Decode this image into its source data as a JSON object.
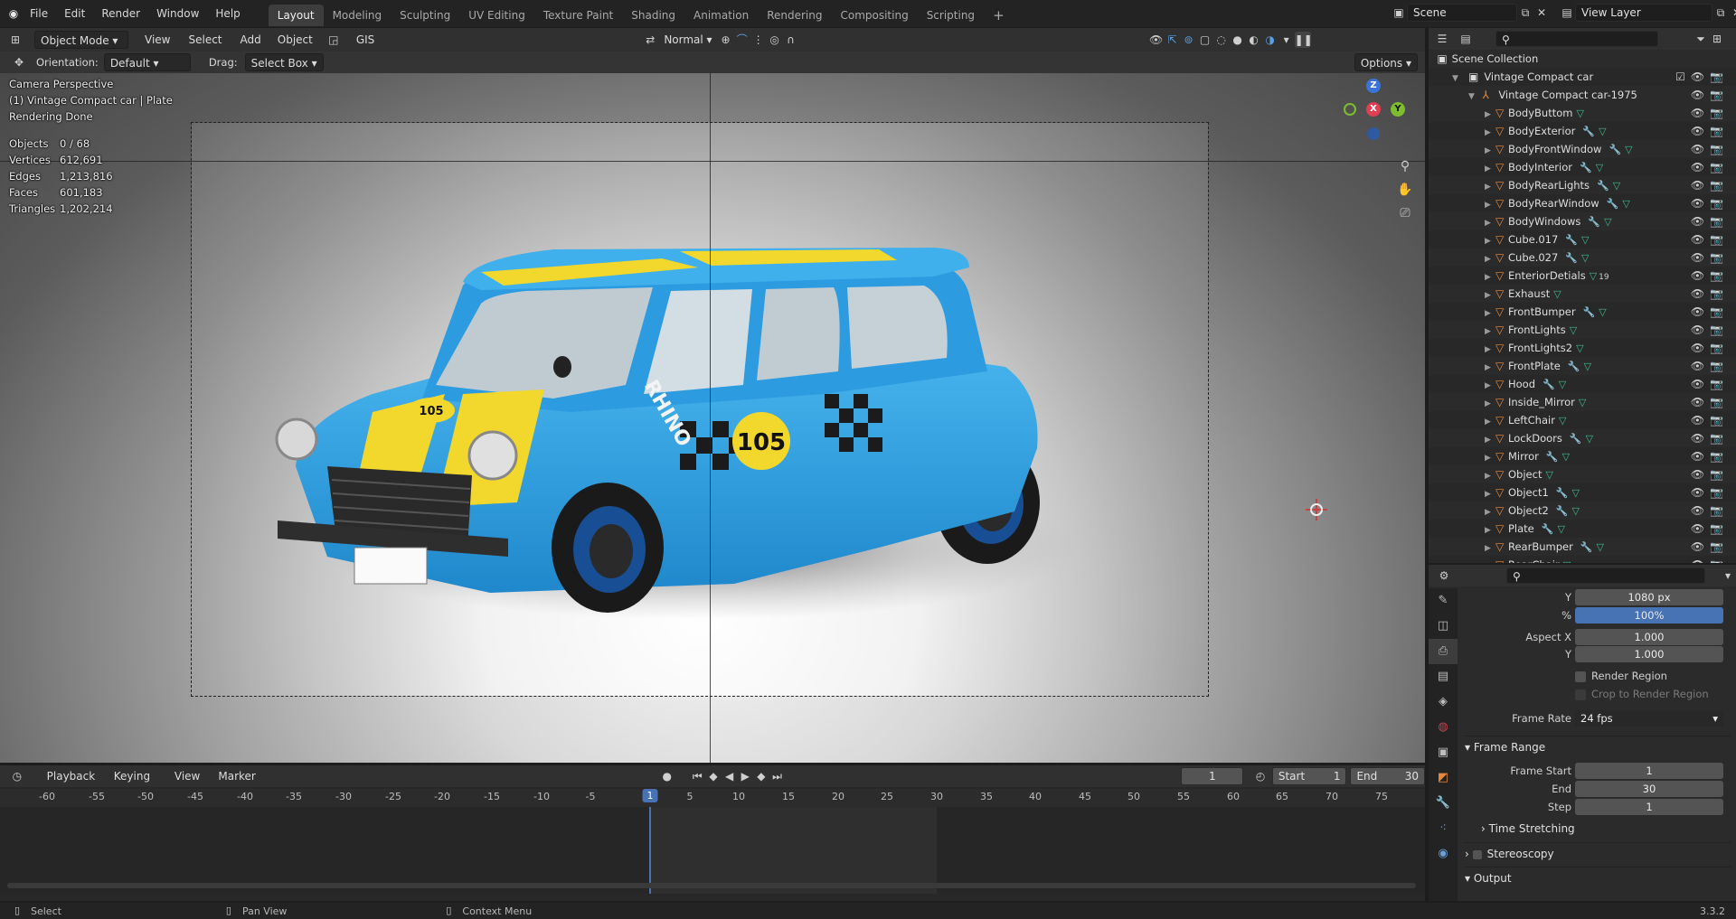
{
  "topbar": {
    "menus": [
      "File",
      "Edit",
      "Render",
      "Window",
      "Help"
    ],
    "workspaces": [
      "Layout",
      "Modeling",
      "Sculpting",
      "UV Editing",
      "Texture Paint",
      "Shading",
      "Animation",
      "Rendering",
      "Compositing",
      "Scripting"
    ],
    "active_workspace": "Layout",
    "add_tab": "+",
    "scene_name": "Scene",
    "view_layer": "View Layer"
  },
  "viewport": {
    "mode": "Object Mode",
    "menus": [
      "View",
      "Select",
      "Add",
      "Object"
    ],
    "gis": "GIS",
    "transform_orientation": "Normal",
    "orientation_label": "Orientation:",
    "orientation_value": "Default",
    "drag_label": "Drag:",
    "drag_value": "Select Box",
    "options": "Options",
    "overlay": {
      "line1": "Camera Perspective",
      "line2": "(1) Vintage Compact car | Plate",
      "line3": "Rendering Done"
    },
    "stats": [
      {
        "k": "Objects",
        "v": "0 / 68"
      },
      {
        "k": "Vertices",
        "v": "612,691"
      },
      {
        "k": "Edges",
        "v": "1,213,816"
      },
      {
        "k": "Faces",
        "v": "601,183"
      },
      {
        "k": "Triangles",
        "v": "1,202,214"
      }
    ],
    "gizmo": {
      "x": "X",
      "y": "Y",
      "z": "Z"
    },
    "car_text": {
      "number": "105",
      "brand": "RHINO"
    }
  },
  "timeline": {
    "menus": [
      "Playback",
      "Keying",
      "View",
      "Marker"
    ],
    "current_frame": "1",
    "start_label": "Start",
    "start": "1",
    "end_label": "End",
    "end": "30",
    "ticks": [
      "-60",
      "-55",
      "-50",
      "-45",
      "-40",
      "-35",
      "-30",
      "-25",
      "-20",
      "-15",
      "-10",
      "-5",
      "1",
      "5",
      "10",
      "15",
      "20",
      "25",
      "30",
      "35",
      "40",
      "45",
      "50",
      "55",
      "60",
      "65",
      "70",
      "75"
    ]
  },
  "statusbar": {
    "select": "Select",
    "pan": "Pan View",
    "context": "Context Menu",
    "version": "3.3.2"
  },
  "outliner": {
    "scene_collection": "Scene Collection",
    "collection": "Vintage Compact car",
    "empty": "Vintage Compact car-1975",
    "objects": [
      {
        "name": "BodyButtom",
        "mod": false
      },
      {
        "name": "BodyExterior",
        "mod": true
      },
      {
        "name": "BodyFrontWindow",
        "mod": true
      },
      {
        "name": "BodyInterior",
        "mod": true
      },
      {
        "name": "BodyRearLights",
        "mod": true
      },
      {
        "name": "BodyRearWindow",
        "mod": true
      },
      {
        "name": "BodyWindows",
        "mod": true
      },
      {
        "name": "Cube.017",
        "mod": true
      },
      {
        "name": "Cube.027",
        "mod": true
      },
      {
        "name": "EnteriorDetials",
        "mod": false,
        "badge": "19"
      },
      {
        "name": "Exhaust",
        "mod": false
      },
      {
        "name": "FrontBumper",
        "mod": true
      },
      {
        "name": "FrontLights",
        "mod": false
      },
      {
        "name": "FrontLights2",
        "mod": false
      },
      {
        "name": "FrontPlate",
        "mod": true
      },
      {
        "name": "Hood",
        "mod": true
      },
      {
        "name": "Inside_Mirror",
        "mod": false
      },
      {
        "name": "LeftChair",
        "mod": false
      },
      {
        "name": "LockDoors",
        "mod": true
      },
      {
        "name": "Mirror",
        "mod": true
      },
      {
        "name": "Object",
        "mod": false
      },
      {
        "name": "Object1",
        "mod": true
      },
      {
        "name": "Object2",
        "mod": true
      },
      {
        "name": "Plate",
        "mod": true
      },
      {
        "name": "RearBumper",
        "mod": true
      },
      {
        "name": "RearChair",
        "mod": false
      }
    ]
  },
  "properties": {
    "res_y_label": "Y",
    "res_y": "1080 px",
    "pct_label": "%",
    "pct": "100%",
    "aspect_x_label": "Aspect X",
    "aspect_x": "1.000",
    "aspect_y_label": "Y",
    "aspect_y": "1.000",
    "render_region": "Render Region",
    "crop_region": "Crop to Render Region",
    "frame_rate_label": "Frame Rate",
    "frame_rate": "24 fps",
    "frame_range": "Frame Range",
    "frame_start_label": "Frame Start",
    "frame_start": "1",
    "end_label": "End",
    "end": "30",
    "step_label": "Step",
    "step": "1",
    "time_stretching": "Time Stretching",
    "stereoscopy": "Stereoscopy",
    "output": "Output"
  }
}
